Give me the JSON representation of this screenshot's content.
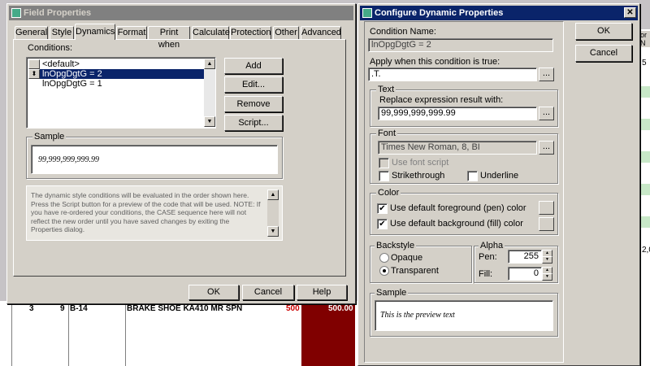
{
  "field_properties": {
    "title": "Field Properties",
    "tabs": [
      "General",
      "Style",
      "Dynamics",
      "Format",
      "Print when",
      "Calculate",
      "Protection",
      "Other",
      "Advanced"
    ],
    "selected_tab": "Dynamics",
    "conditions_label": "Conditions:",
    "conditions": [
      "<default>",
      "lnOpgDgtG = 2",
      "lnOpgDgtG = 1"
    ],
    "selected_condition": 1,
    "buttons": {
      "add": "Add",
      "edit": "Edit...",
      "remove": "Remove",
      "script": "Script..."
    },
    "sample_label": "Sample",
    "sample_text": "99,999,999,999.99",
    "note": "The dynamic style conditions will be evaluated in the order shown here. Press the Script button for a preview of the code that will be used. NOTE: If you have re-ordered your conditions, the CASE sequence here will not reflect the new order until you have saved changes by exiting the Properties dialog.",
    "ok": "OK",
    "cancel": "Cancel",
    "help": "Help"
  },
  "configure_dynamic": {
    "title": "Configure Dynamic Properties",
    "ok": "OK",
    "cancel": "Cancel",
    "condition_name_label": "Condition Name:",
    "condition_name": "lnOpgDgtG = 2",
    "apply_label": "Apply when this condition is true:",
    "apply_value": ".T.",
    "browse": "...",
    "text_group": "Text",
    "replace_label": "Replace expression result with:",
    "replace_value": "99,999,999,999.99",
    "font_group": "Font",
    "font_value": "Times New Roman, 8, BI",
    "use_font_script": "Use font script",
    "strikethrough": "Strikethrough",
    "underline": "Underline",
    "color_group": "Color",
    "use_default_fg": "Use default foreground (pen) color",
    "use_default_bg": "Use default background (fill) color",
    "backstyle_group": "Backstyle",
    "opaque": "Opaque",
    "transparent": "Transparent",
    "alpha_group": "Alpha",
    "pen_label": "Pen:",
    "pen_value": "255",
    "fill_label": "Fill:",
    "fill_value": "0",
    "sample_group": "Sample",
    "preview_text": "This is the preview text"
  },
  "background": {
    "row_num": "3",
    "row_col2": "9",
    "row_code": "B-14",
    "row_desc": "BRAKE SHOE KA410 MR SPN",
    "row_val1": "500",
    "row_val2": "500.00",
    "right_cell_1": "5",
    "right_cell_2": "2,0",
    "right_header": "or N"
  },
  "colors": {
    "dark_red": "#800000",
    "purple": "#8000ff",
    "selection": "#0a246a",
    "green_row": "#c8e8c8"
  }
}
